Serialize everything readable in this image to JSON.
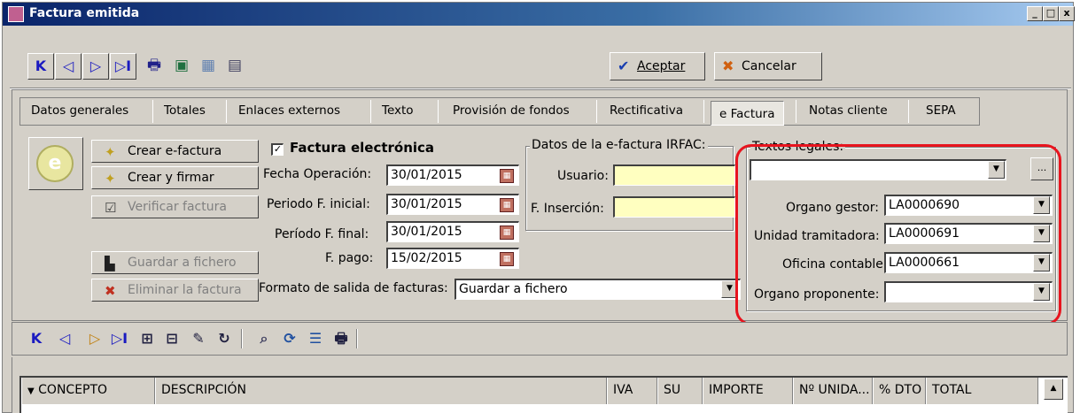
{
  "window": {
    "title": "Factura emitida",
    "controls": [
      "_",
      "□",
      "x"
    ]
  },
  "toolbar": {
    "nav_buttons": [
      "K",
      "◁",
      "▷",
      "▷I"
    ],
    "accept_label": "Aceptar",
    "cancel_label": "Cancelar"
  },
  "tabs": [
    "Datos generales",
    "Totales",
    "Enlaces externos",
    "Texto",
    "Provisión de fondos",
    "Rectificativa",
    "e Factura",
    "Notas cliente",
    "SEPA"
  ],
  "active_tab": "e Factura",
  "actions": {
    "crear_efactura": "Crear e-factura",
    "crear_firmar": "Crear y firmar",
    "verificar": "Verificar factura",
    "guardar": "Guardar a fichero",
    "eliminar": "Eliminar la factura"
  },
  "form": {
    "factura_electronica_label": "Factura electrónica",
    "factura_electronica_checked": true,
    "fecha_operacion_label": "Fecha Operación:",
    "fecha_operacion": "30/01/2015",
    "periodo_inicial_label": "Periodo F. inicial:",
    "periodo_inicial": "30/01/2015",
    "periodo_final_label": "Período F. final:",
    "periodo_final": "30/01/2015",
    "f_pago_label": "F. pago:",
    "f_pago": "15/02/2015",
    "formato_label": "Formato de salida de facturas:",
    "formato_value": "Guardar a fichero"
  },
  "irfac": {
    "group_title": "Datos de la e-factura IRFAC:",
    "usuario_label": "Usuario:",
    "usuario": "",
    "insercion_label": "F. Inserción:",
    "insercion": ""
  },
  "legales": {
    "group_title": "Textos legales:",
    "textos_value": "",
    "ellipsis": "...",
    "organo_gestor_label": "Organo gestor:",
    "organo_gestor": "LA0000690",
    "unidad_label": "Unidad tramitadora:",
    "unidad": "LA0000691",
    "oficina_label": "Oficina contable:",
    "oficina": "LA0000661",
    "proponente_label": "Organo proponente:",
    "proponente": ""
  },
  "grid": {
    "columns": [
      "CONCEPTO",
      "DESCRIPCIÓN",
      "IVA",
      "SU",
      "IMPORTE",
      "Nº UNIDA...",
      "% DTO",
      "TOTAL"
    ]
  },
  "colors": {
    "highlight": "#e8141e",
    "titlebar": "#0a246a",
    "field_yellow": "#ffffc0"
  }
}
